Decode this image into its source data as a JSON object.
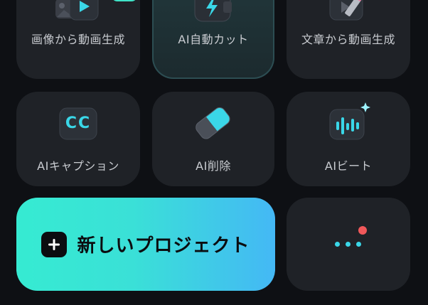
{
  "tiles_row1": [
    {
      "label": "画像から動画生成",
      "icon": "image-to-video-icon"
    },
    {
      "label": "AI自動カット",
      "icon": "lightning-card-icon"
    },
    {
      "label": "文章から動画生成",
      "icon": "text-to-video-pen-icon"
    }
  ],
  "tiles_row2": [
    {
      "label": "AIキャプション",
      "icon": "cc-caption-icon",
      "icon_text": "CC"
    },
    {
      "label": "AI削除",
      "icon": "eraser-icon"
    },
    {
      "label": "AIビート",
      "icon": "beat-waveform-icon"
    }
  ],
  "new_project": {
    "label": "新しいプロジェクト",
    "icon": "plus-icon"
  },
  "more": {
    "icon": "more-dots-icon",
    "notification": "red-dot-badge"
  },
  "colors": {
    "background": "#0e1014",
    "tile": "#1f2227",
    "accent_start": "#36ebd2",
    "accent_end": "#44b8f5",
    "notification": "#f0585a"
  }
}
